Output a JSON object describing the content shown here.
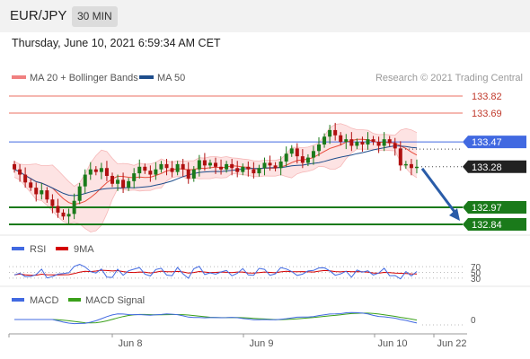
{
  "header": {
    "pair": "EUR/JPY",
    "interval": "30 MIN",
    "timestamp": "Thursday, June 10, 2021 6:59:34 AM CET"
  },
  "legend": {
    "ma20_label": "MA 20 + Bollinger Bands",
    "ma20_color": "#f08080",
    "ma50_label": "MA 50",
    "ma50_color": "#1f4e8c",
    "credit": "Research © 2021 Trading Central"
  },
  "colors": {
    "resistance": "#e74c3c",
    "pivot": "#4169e1",
    "support": "#1a7a1a",
    "up_candle": "#1a7a1a",
    "down_candle": "#b01010",
    "band_fill": "#fde3e3",
    "rsi": "#4169e1",
    "rsi_ma": "#d40000",
    "macd": "#4169e1",
    "macd_signal": "#3aa01a"
  },
  "chart_data": [
    {
      "type": "candlestick",
      "ylim": [
        132.7,
        133.95
      ],
      "xlabels": [
        "Jun 8",
        "Jun 9",
        "Jun 10",
        "Jun 22"
      ],
      "levels": [
        {
          "value": 133.82,
          "kind": "resistance",
          "label": "133.82"
        },
        {
          "value": 133.69,
          "kind": "resistance",
          "label": "133.69"
        },
        {
          "value": 133.47,
          "kind": "pivot",
          "label": "133.47"
        },
        {
          "value": 132.97,
          "kind": "support",
          "label": "132.97"
        },
        {
          "value": 132.84,
          "kind": "support",
          "label": "132.84"
        }
      ],
      "last_price": {
        "value": 133.28,
        "label": "133.28"
      },
      "path": [
        133.3,
        133.26,
        133.22,
        133.16,
        133.12,
        133.07,
        133.1,
        133.03,
        132.98,
        132.93,
        132.9,
        132.92,
        133.02,
        133.13,
        133.22,
        133.26,
        133.24,
        133.27,
        133.21,
        133.15,
        133.18,
        133.12,
        133.17,
        133.23,
        133.28,
        133.25,
        133.22,
        133.26,
        133.3,
        133.27,
        133.24,
        133.3,
        133.26,
        133.19,
        133.26,
        133.33,
        133.29,
        133.31,
        133.28,
        133.26,
        133.3,
        133.27,
        133.24,
        133.28,
        133.26,
        133.23,
        133.27,
        133.31,
        133.29,
        133.27,
        133.32,
        133.38,
        133.42,
        133.36,
        133.31,
        133.35,
        133.4,
        133.45,
        133.51,
        133.56,
        133.52,
        133.47,
        133.49,
        133.44,
        133.47,
        133.45,
        133.49,
        133.47,
        133.44,
        133.49,
        133.46,
        133.42,
        133.29,
        133.3,
        133.27,
        133.28
      ]
    },
    {
      "type": "line",
      "name_rsi": "RSI",
      "name_ma": "9MA",
      "levels": [
        "70",
        "50",
        "30"
      ],
      "ylim": [
        20,
        80
      ]
    },
    {
      "type": "line",
      "name_macd": "MACD",
      "name_signal": "MACD Signal",
      "levels": [
        "0"
      ]
    }
  ]
}
